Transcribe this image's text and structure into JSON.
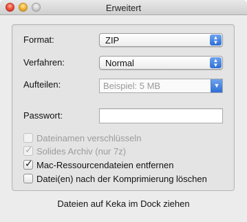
{
  "window": {
    "title": "Erweitert"
  },
  "format": {
    "label": "Format:",
    "value": "ZIP"
  },
  "verfahren": {
    "label": "Verfahren:",
    "value": "Normal"
  },
  "aufteilen": {
    "label": "Aufteilen:",
    "placeholder": "Beispiel: 5 MB"
  },
  "passwort": {
    "label": "Passwort:",
    "value": ""
  },
  "checkboxes": [
    {
      "label": "Dateinamen verschlüsseln",
      "checked": false,
      "enabled": false
    },
    {
      "label": "Solides Archiv (nur 7z)",
      "checked": true,
      "enabled": false
    },
    {
      "label": "Mac-Ressourcendateien entfernen",
      "checked": true,
      "enabled": true
    },
    {
      "label": "Datei(en) nach der Komprimierung löschen",
      "checked": false,
      "enabled": true
    }
  ],
  "footer": {
    "text": "Dateien auf Keka im Dock ziehen"
  },
  "icons": {
    "close": "close-traffic-light",
    "minimize": "minimize-traffic-light",
    "zoom": "zoom-traffic-light",
    "popup_arrows": "up-down-arrows-icon",
    "combo_arrow": "chevron-down-icon",
    "checkmark": "checkmark-icon"
  },
  "colors": {
    "accent": "#3a78d8"
  }
}
